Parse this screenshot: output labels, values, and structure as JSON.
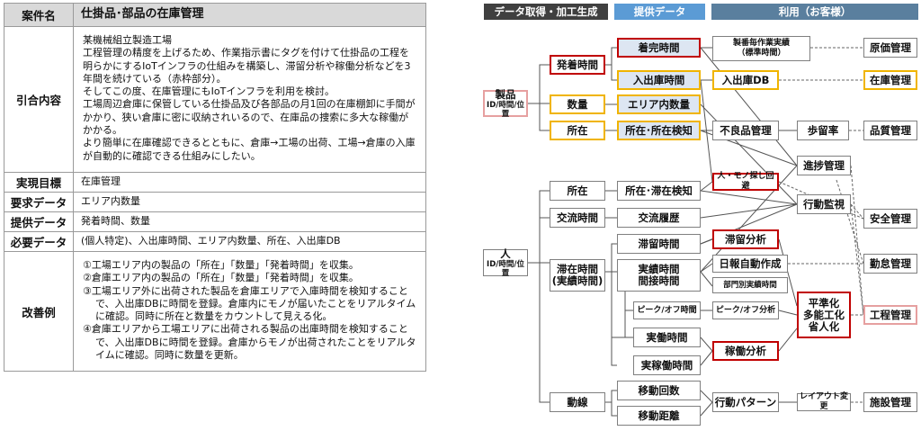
{
  "table": {
    "title_header": "案件名",
    "title_value": "仕掛品･部品の在庫管理",
    "background_header": "引合内容",
    "background_paragraphs": [
      "某機械組立製造工場",
      "工程管理の精度を上げるため、作業指示書にタグを付けて仕掛品の工程を明らかにするIoTインフラの仕組みを構築し、滞留分析や稼働分析などを3年間を続けている（赤枠部分）。",
      "そしてこの度、在庫管理にもIoTインフラを利用を検討。",
      "工場周辺倉庫に保管している仕掛品及び各部品の月1回の在庫棚卸に手間がかかり、狭い倉庫に密に収納されいるので、在庫品の捜索に多大な稼働がかかる。",
      "より簡単に在庫確認できるとともに、倉庫→工場の出荷、工場→倉庫の入庫が自動的に確認できる仕組みにしたい。"
    ],
    "goal_header": "実現目標",
    "goal_value": "在庫管理",
    "required_header": "要求データ",
    "required_value": "エリア内数量",
    "provided_header": "提供データ",
    "provided_value": "発着時間、数量",
    "needed_header": "必要データ",
    "needed_value": "(個人特定)、入出庫時間、エリア内数量、所在、入出庫DB",
    "improve_header": "改善例",
    "improve_items": [
      "①工場エリア内の製品の「所在」「数量」「発着時間」を収集。",
      "②倉庫エリア内の製品の「所在」「数量」「発着時間」を収集。",
      "③工場エリア外に出荷された製品を倉庫エリアで入庫時間を検知することで、入出庫DBに時間を登録。倉庫内にモノが届いたことをリアルタイムに確認。同時に所在と数量をカウントして見える化。",
      "④倉庫エリアから工場エリアに出荷される製品の出庫時間を検知することで、入出庫DBに時間を登録。倉庫からモノが出荷されたことをリアルタイムに確認。同時に数量を更新。"
    ]
  },
  "diagram": {
    "headers": {
      "acquire": "データ取得・加工生成",
      "provide": "提供データ",
      "use": "利用（お客様）"
    },
    "sources": {
      "product": "製品",
      "product_sub": "ID/時間/位置",
      "person": "人",
      "person_sub": "ID/時間/位置"
    },
    "product_level1": {
      "arrival": "発着時間",
      "quantity": "数量",
      "location": "所在"
    },
    "product_level2": {
      "finish": "着完時間",
      "inout": "入出庫時間",
      "area_qty": "エリア内数量",
      "loc_detect": "所在･所在検知"
    },
    "person_level1": {
      "location": "所在",
      "exchange": "交流時間",
      "stay": "滞在時間",
      "stay_sub": "(実績時間)",
      "route": "動線"
    },
    "person_level2": {
      "loc_detect": "所在･滞在検知",
      "exchange_hist": "交流履歴",
      "dwell": "滞留時間",
      "work": "実績時間",
      "work_sub": "間接時間",
      "peak": "ピーク/オフ時間",
      "actual": "実働時間",
      "actual_op": "実稼働時間",
      "move_count": "移動回数",
      "move_dist": "移動距離"
    },
    "use_level1": {
      "std_time": "製番毎作業実績",
      "std_time_sub": "（標準時間）",
      "inout_db": "入出庫DB",
      "defect": "不良品管理",
      "yield": "歩留率",
      "progress": "進捗管理",
      "search": "人・モノ探し回避",
      "monitor": "行動監視",
      "dwell_analysis": "滞留分析",
      "daily_report": "日報自動作成",
      "dept_record": "部門別実績時間",
      "peak_analysis": "ピーク/オフ分析",
      "leveling": "平準化",
      "multi_skill": "多能工化",
      "labor_saving": "省人化",
      "op_analysis": "稼働分析",
      "behavior": "行動パターン",
      "layout": "レイアウト変更"
    },
    "outputs": {
      "cost": "原価管理",
      "inventory": "在庫管理",
      "quality": "品質管理",
      "safety": "安全管理",
      "attendance": "勤怠管理",
      "process": "工程管理",
      "facility": "施設管理"
    },
    "colors": {
      "red_border": "#c00000",
      "yellow_border": "#f0b400",
      "pink_border": "#e6a0a0",
      "header_dark": "#404040",
      "header_blue": "#5b9bd5",
      "header_steel": "#5a7f9e",
      "provided_fill": "#dde6f2"
    }
  }
}
